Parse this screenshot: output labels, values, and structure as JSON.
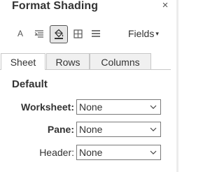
{
  "header": {
    "title": "Format Shading",
    "close_glyph": "×"
  },
  "toolbar": {
    "icons": [
      "font-icon",
      "alignment-icon",
      "shading-icon",
      "borders-icon",
      "lines-icon"
    ],
    "selected": "shading-icon",
    "font_glyph": "A",
    "fields_label": "Fields",
    "fields_caret": "▾"
  },
  "tabs": [
    {
      "label": "Sheet",
      "active": true
    },
    {
      "label": "Rows",
      "active": false
    },
    {
      "label": "Columns",
      "active": false
    }
  ],
  "section": {
    "title": "Default"
  },
  "rows": [
    {
      "label": "Worksheet:",
      "value": "None",
      "bold": true
    },
    {
      "label": "Pane:",
      "value": "None",
      "bold": true
    },
    {
      "label": "Header:",
      "value": "None",
      "bold": false
    }
  ],
  "colors": {
    "selected_icon_bg": "#e6e6e6",
    "border": "#c8c8c8",
    "text": "#333333"
  }
}
